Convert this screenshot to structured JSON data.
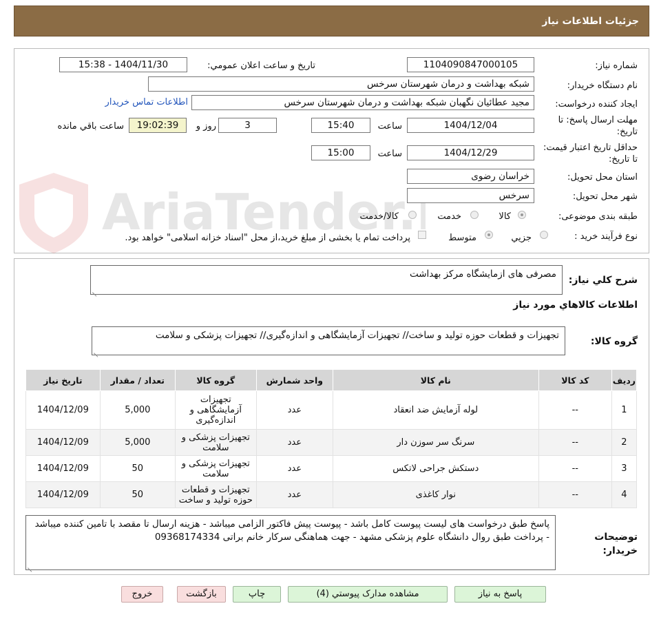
{
  "header": {
    "title": "جزئیات اطلاعات نیاز"
  },
  "form": {
    "need_number_label": "شماره نیاز:",
    "need_number": "1104090847000105",
    "announce_label": "تاریخ و ساعت اعلان عمومي:",
    "announce_value": "1404/11/30 - 15:38",
    "buyer_org_label": "نام دستگاه خريدار:",
    "buyer_org": "شبکه بهداشت و درمان شهرستان سرخس",
    "creator_label": "ایجاد کننده درخواست:",
    "creator": "مجید عطائیان نگهبان شبکه بهداشت و درمان شهرستان سرخس",
    "contact_link": "اطلاعات تماس خریدار",
    "deadline_label": "مهلت ارسال پاسخ: تا تاریخ:",
    "deadline_date": "1404/12/04",
    "time_label": "ساعت",
    "deadline_time": "15:40",
    "days_value": "3",
    "days_and_label": "روز و",
    "remaining_time": "19:02:39",
    "remaining_label": "ساعت باقي مانده",
    "validity_label": "حداقل تاریخ اعتبار قیمت: تا تاریخ:",
    "validity_date": "1404/12/29",
    "validity_time": "15:00",
    "province_label": "استان محل تحویل:",
    "province": "خراسان رضوی",
    "city_label": "شهر محل تحویل:",
    "city": "سرخس",
    "category_label": "طبقه بندی موضوعی:",
    "category_options": [
      "کالا",
      "خدمت",
      "کالا/خدمت"
    ],
    "process_label": "نوع فرآیند خرید :",
    "process_options": [
      "جزيي",
      "متوسط"
    ],
    "payment_note": "پرداخت تمام یا بخشی از مبلغ خرید،از محل \"اسناد خزانه اسلامی\" خواهد بود."
  },
  "general": {
    "summary_label": "شرح کلي نياز:",
    "summary": "مصرفی های ازمایشگاه مرکز بهداشت",
    "goods_info_title": "اطلاعات کالاهاي مورد نياز",
    "goods_group_label": "گروه کالا:",
    "goods_group": "تجهیزات و قطعات حوزه تولید و ساخت// تجهیزات آزمایشگاهی و اندازه‌گیری// تجهیزات پزشکی و سلامت"
  },
  "table": {
    "headers": [
      "رديف",
      "کد کالا",
      "نام کالا",
      "واحد شمارش",
      "گروه کالا",
      "تعداد / مقدار",
      "تاريخ نياز"
    ],
    "rows": [
      [
        "1",
        "--",
        "لوله آزمایش ضد انعقاد",
        "عدد",
        "تجهیزات آزمایشگاهی و اندازه‌گیری",
        "5,000",
        "1404/12/09"
      ],
      [
        "2",
        "--",
        "سرنگ سر سوزن دار",
        "عدد",
        "تجهیزات پزشکی و سلامت",
        "5,000",
        "1404/12/09"
      ],
      [
        "3",
        "--",
        "دستکش جراحی لاتکس",
        "عدد",
        "تجهیزات پزشکی و سلامت",
        "50",
        "1404/12/09"
      ],
      [
        "4",
        "--",
        "نوار کاغذی",
        "عدد",
        "تجهیزات و قطعات حوزه تولید و ساخت",
        "50",
        "1404/12/09"
      ]
    ]
  },
  "notes": {
    "label": "توضیحات خریدار:",
    "text": "پاسخ طبق درخواست های لیست پیوست کامل باشد - پیوست پیش فاکتور الزامی میباشد -  هزینه ارسال تا مقصد با تامین کننده میباشد - پرداخت طبق روال دانشگاه علوم پزشکی مشهد - جهت هماهنگی سرکار خانم براتی 09368174334"
  },
  "buttons": {
    "reply": "پاسخ به نياز",
    "attachments": "مشاهده مدارک پيوستي (4)",
    "print": "چاپ",
    "back": "بازگشت",
    "exit": "خروج"
  },
  "watermark": {
    "text": "AriaTender.neT"
  },
  "colors": {
    "header_bg": "#8b6c45",
    "highlight_field": "#f4f4cc",
    "button_green": "#dcf5d8",
    "button_pink": "#f9dede",
    "link": "#2255bb"
  }
}
